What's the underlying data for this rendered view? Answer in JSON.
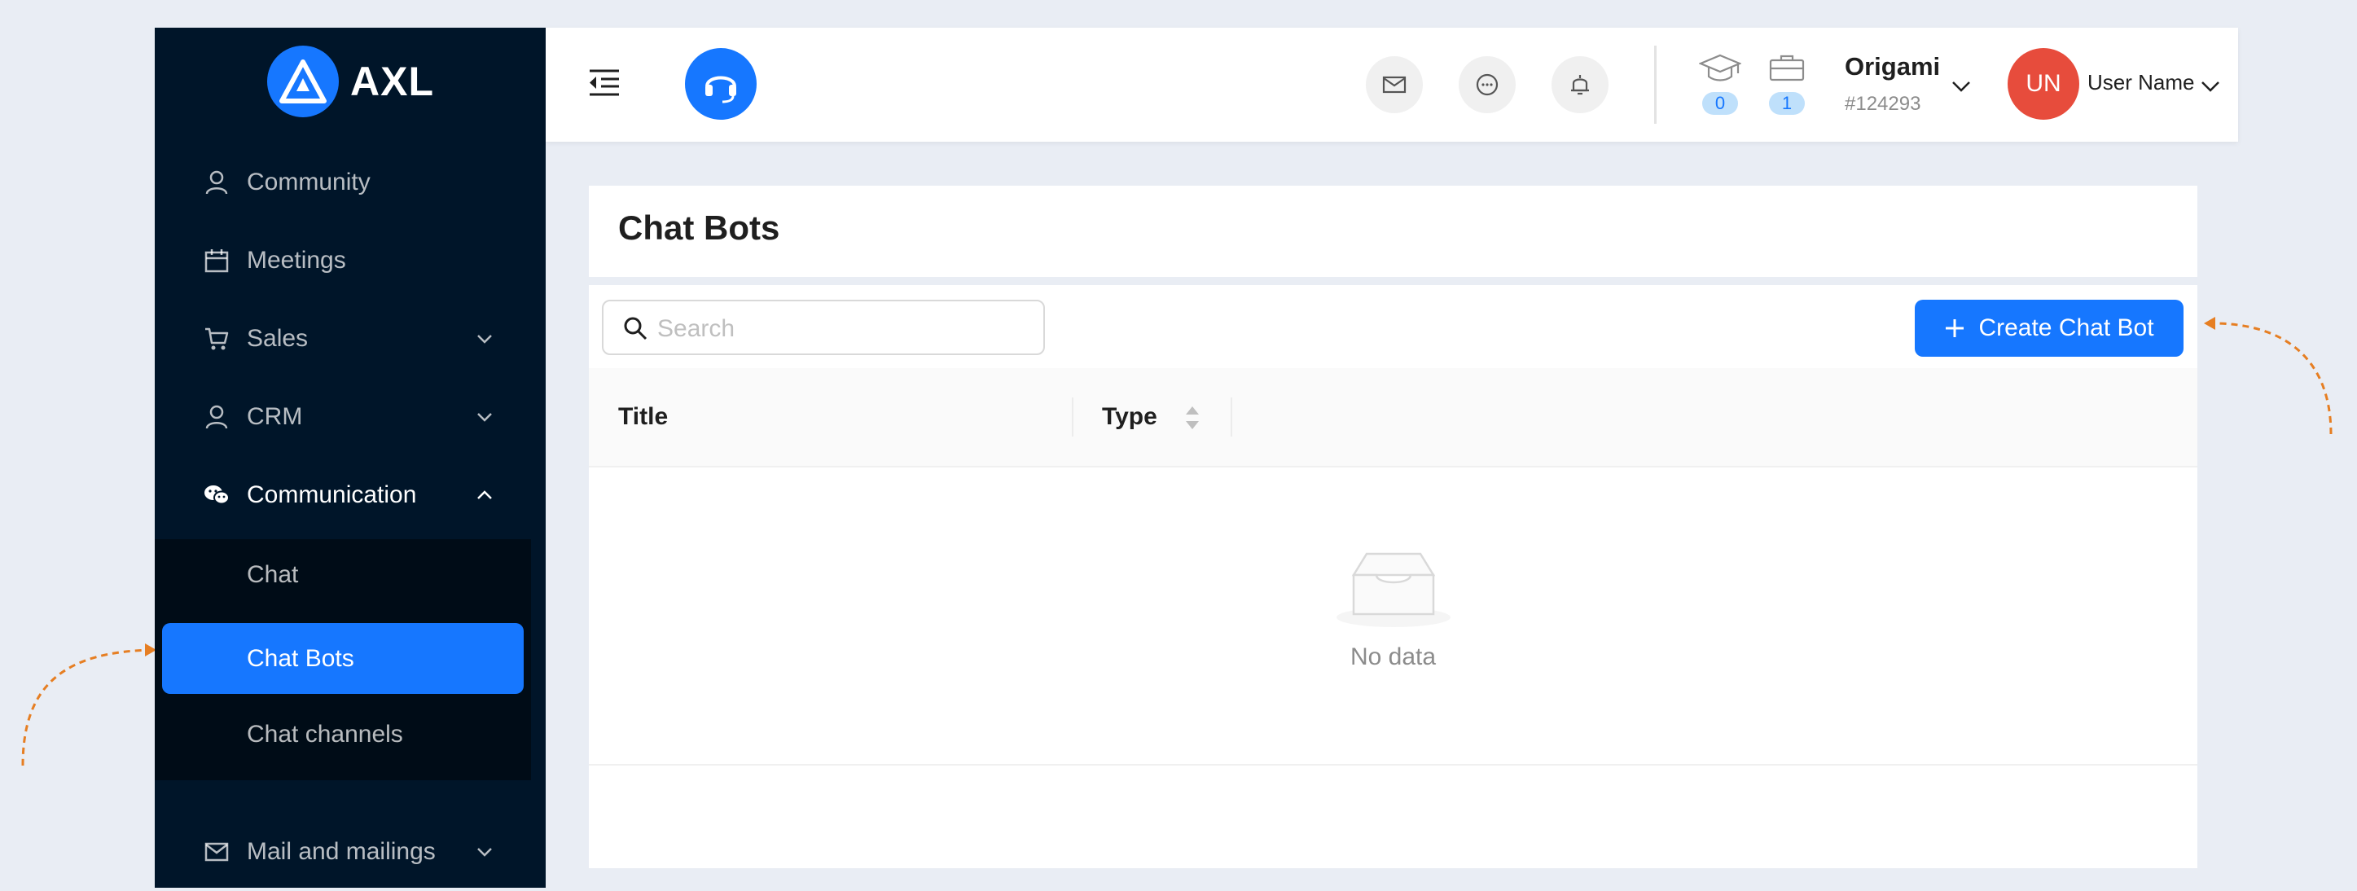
{
  "app": {
    "logo_text": "AXL"
  },
  "sidebar": {
    "items": [
      {
        "label": "Community",
        "icon": "user-icon"
      },
      {
        "label": "Meetings",
        "icon": "calendar-icon"
      },
      {
        "label": "Sales",
        "icon": "cart-icon",
        "expandable": true
      },
      {
        "label": "CRM",
        "icon": "user-icon",
        "expandable": true
      },
      {
        "label": "Communication",
        "icon": "wechat-icon",
        "expanded": true
      },
      {
        "label": "Mail and mailings",
        "icon": "mail-icon",
        "expandable": true
      }
    ],
    "communication_sub": [
      {
        "label": "Chat"
      },
      {
        "label": "Chat Bots",
        "active": true
      },
      {
        "label": "Chat channels"
      }
    ]
  },
  "header": {
    "counters": [
      {
        "icon": "graduation-cap-icon",
        "value": "0"
      },
      {
        "icon": "briefcase-icon",
        "value": "1"
      }
    ],
    "org_name": "Origami",
    "org_id": "#124293",
    "avatar_initials": "UN",
    "user_name": "User Name"
  },
  "page": {
    "title": "Chat Bots",
    "search_placeholder": "Search",
    "create_button_label": "Create Chat Bot",
    "table": {
      "columns": [
        "Title",
        "Type"
      ],
      "empty_text": "No data"
    }
  },
  "colors": {
    "accent": "#1677ff",
    "sidebar_bg": "#001529",
    "avatar_bg": "#e74c3c",
    "annotation_arrow": "#e67e22"
  }
}
